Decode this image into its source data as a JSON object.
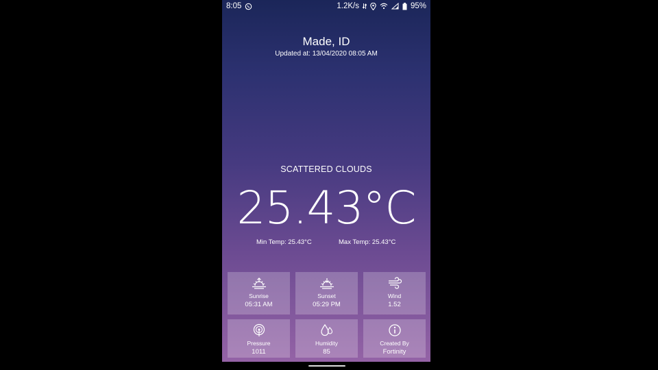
{
  "status_bar": {
    "time": "8:05",
    "network_speed": "1.2K/s",
    "battery": "95%",
    "icons": [
      "whatsapp-icon",
      "data-arrows-icon",
      "location-icon",
      "wifi-icon",
      "signal-icon",
      "battery-icon"
    ]
  },
  "header": {
    "location": "Made, ID",
    "updated": "Updated at: 13/04/2020 08:05 AM"
  },
  "weather": {
    "condition": "SCATTERED CLOUDS",
    "temperature": "25.43°C",
    "min_temp": "Min Temp: 25.43°C",
    "max_temp": "Max Temp: 25.43°C"
  },
  "details": [
    {
      "icon": "sunrise-icon",
      "label": "Sunrise",
      "value": "05:31 AM"
    },
    {
      "icon": "sunset-icon",
      "label": "Sunset",
      "value": "05:29 PM"
    },
    {
      "icon": "wind-icon",
      "label": "Wind",
      "value": "1.52"
    },
    {
      "icon": "pressure-icon",
      "label": "Pressure",
      "value": "1011"
    },
    {
      "icon": "humidity-icon",
      "label": "Humidity",
      "value": "85"
    },
    {
      "icon": "info-icon",
      "label": "Created By",
      "value": "Fortinity"
    }
  ],
  "colors": {
    "background_top": "#1b2659",
    "background_bottom": "#9463a6",
    "tile": "rgba(255,255,255,0.22)",
    "text": "#ffffff"
  }
}
